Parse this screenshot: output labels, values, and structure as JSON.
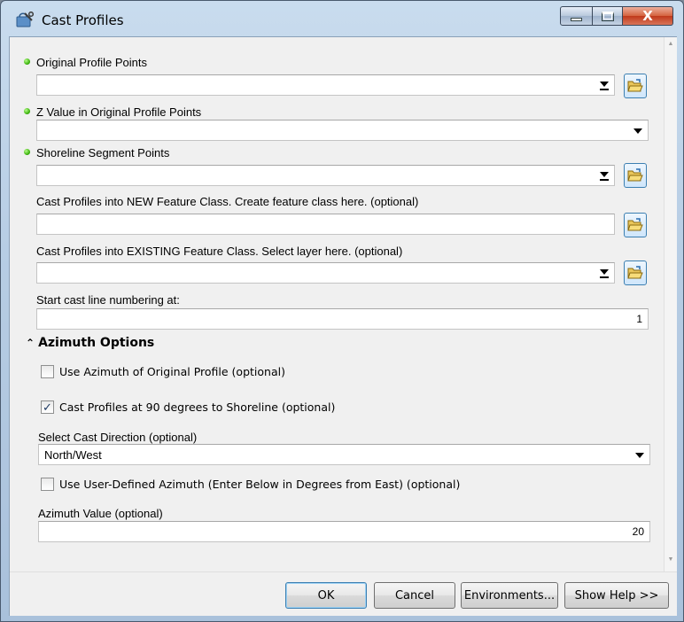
{
  "window": {
    "title": "Cast Profiles",
    "close_glyph": "X"
  },
  "fields": {
    "original_profile_points": {
      "label": "Original Profile Points",
      "value": ""
    },
    "z_value": {
      "label": "Z Value in Original Profile Points",
      "value": ""
    },
    "shoreline_segment_points": {
      "label": "Shoreline Segment Points",
      "value": ""
    },
    "new_feature_class": {
      "label": "Cast Profiles into NEW Feature Class.  Create feature class here. (optional)",
      "value": ""
    },
    "existing_feature_class": {
      "label": "Cast Profiles into EXISTING Feature Class.  Select layer here. (optional)",
      "value": ""
    },
    "start_numbering": {
      "label": "Start cast line numbering at:",
      "value": "1"
    }
  },
  "azimuth_options": {
    "heading": "Azimuth Options",
    "use_original_azimuth": {
      "label": "Use Azimuth of Original Profile (optional)",
      "checked": false
    },
    "cast_90_degrees": {
      "label": "Cast Profiles at 90 degrees to Shoreline (optional)",
      "checked": true,
      "check_glyph": "✓"
    },
    "cast_direction": {
      "label": "Select Cast Direction (optional)",
      "value": "North/West"
    },
    "use_user_azimuth": {
      "label": "Use User-Defined Azimuth (Enter Below in Degrees from East) (optional)",
      "checked": false
    },
    "azimuth_value": {
      "label": "Azimuth Value (optional)",
      "value": "20"
    }
  },
  "buttons": {
    "ok": "OK",
    "cancel": "Cancel",
    "environments": "Environments...",
    "show_help": "Show Help >>"
  },
  "icons": {
    "app": "toolbox-script-icon",
    "required": "green-dot-icon",
    "browse": "open-folder-icon",
    "dropdown": "dropdown-arrow-icon",
    "collapse": "double-chevron-up-icon"
  },
  "colors": {
    "title_bar": "#b7cde4",
    "close_button": "#c0391b",
    "required_dot": "#2fa800",
    "focus_border": "#3c7fb1"
  }
}
